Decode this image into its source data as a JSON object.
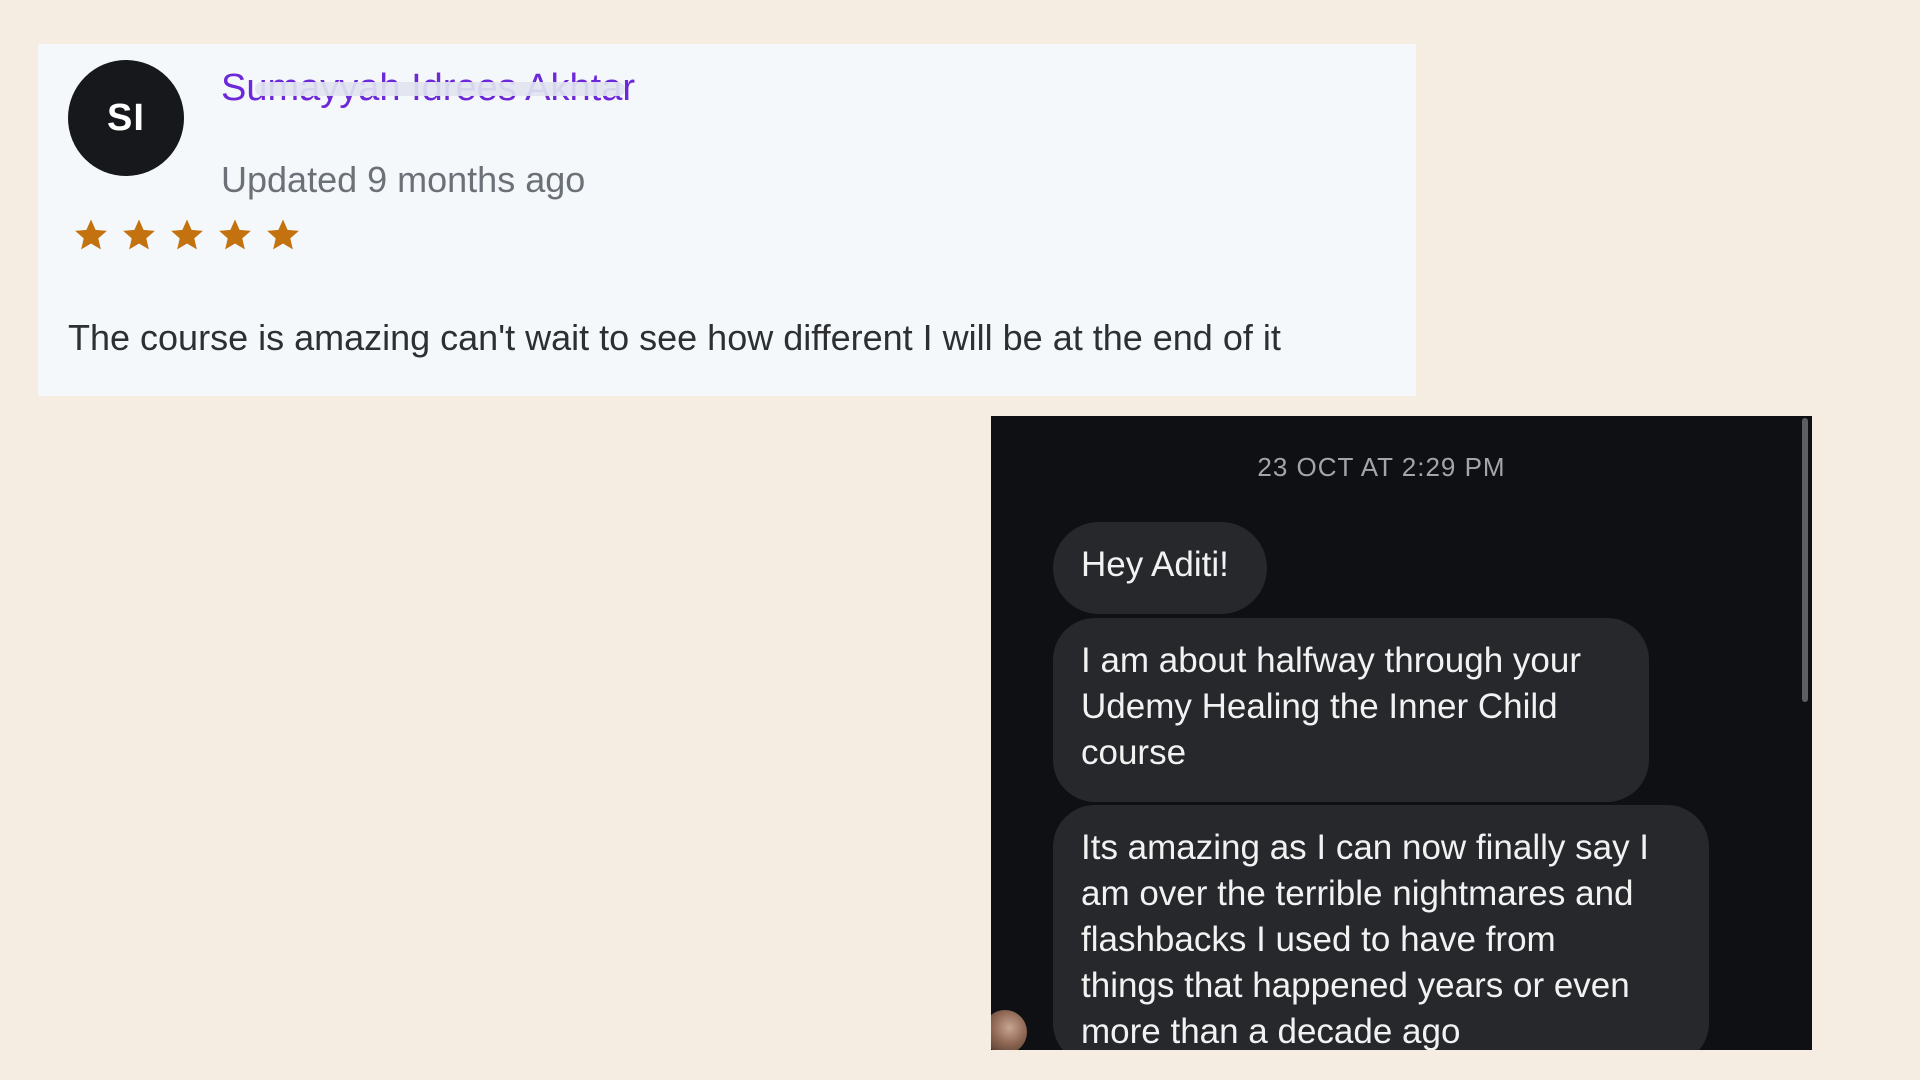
{
  "review": {
    "avatar_initials": "SI",
    "reviewer_name": "Sumayyah Idrees Akhtar",
    "updated": "Updated 9 months ago",
    "rating": 5,
    "rating_max": 5,
    "star_color": "#c4710f",
    "name_color": "#6d28d9",
    "body": "The course is amazing can't wait to see how different I will be at the end of it"
  },
  "chat": {
    "timestamp": "23 OCT AT 2:29 PM",
    "messages": [
      {
        "text": "Hey Aditi!"
      },
      {
        "text": "I am about halfway through your\nUdemy Healing the Inner Child\ncourse"
      },
      {
        "text": "Its amazing as I can now finally say I\nam over the terrible nightmares and\nflashbacks I used to have from\nthings that happened years or even\nmore than a decade ago"
      }
    ],
    "sender_avatar_icon": "profile-photo-icon"
  }
}
